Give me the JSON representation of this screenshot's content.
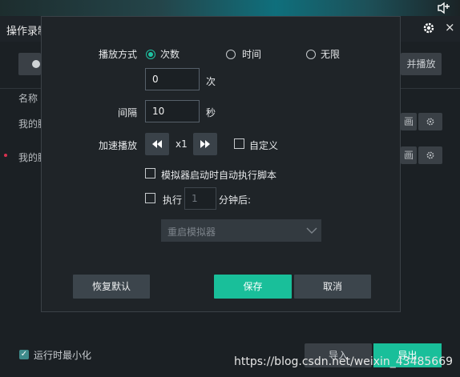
{
  "background": {
    "title": "操作录制",
    "top_button_right": "并播放",
    "column_header": "名称",
    "rows": [
      {
        "text": "我的脚"
      },
      {
        "text": "我的脚"
      }
    ],
    "row_button_text": "画",
    "minimize_label": "运行时最小化",
    "import_label": "导入",
    "export_label": "导出",
    "close_glyph": "×"
  },
  "dialog": {
    "play_mode_label": "播放方式",
    "play_mode_options": [
      {
        "label": "次数",
        "selected": true
      },
      {
        "label": "时间",
        "selected": false
      },
      {
        "label": "无限",
        "selected": false
      }
    ],
    "count_value": "0",
    "count_unit": "次",
    "interval_label": "间隔",
    "interval_value": "10",
    "interval_unit": "秒",
    "speed_label": "加速播放",
    "speed_value": "x1",
    "custom_label": "自定义",
    "auto_run_label": "模拟器启动时自动执行脚本",
    "execute_label": "执行",
    "execute_minutes_value": "1",
    "execute_after_label": "分钟后:",
    "action_select_value": "重启模拟器",
    "restore_button": "恢复默认",
    "save_button": "保存",
    "cancel_button": "取消"
  },
  "watermark": "https://blog.csdn.net/weixin_43485669",
  "colors": {
    "accent": "#19bf9a",
    "dialog_bg": "#1f2428",
    "page_bg": "#1b2024"
  }
}
